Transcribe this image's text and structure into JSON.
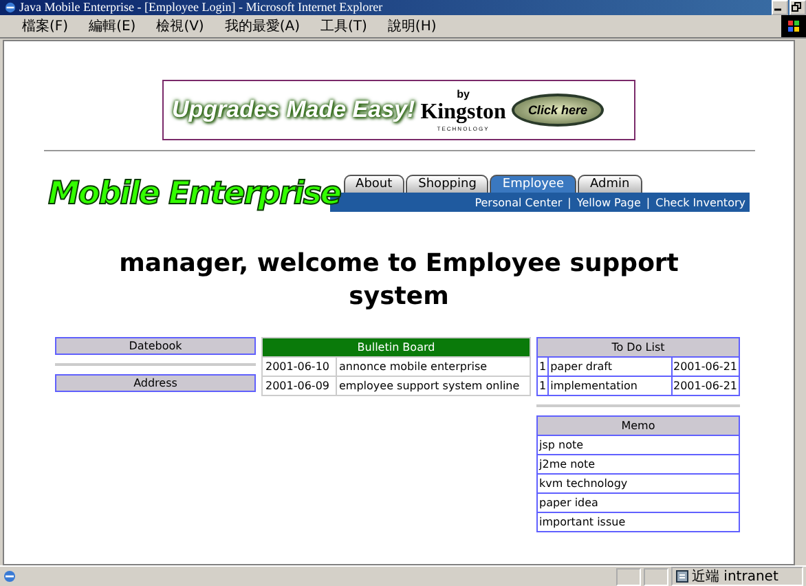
{
  "window": {
    "title": "Java Mobile Enterprise - [Employee Login] - Microsoft Internet Explorer"
  },
  "menu": [
    "檔案(F)",
    "編輯(E)",
    "檢視(V)",
    "我的最愛(A)",
    "工具(T)",
    "說明(H)"
  ],
  "banner": {
    "headline": "Upgrades Made Easy!",
    "by": "by",
    "brand": "Kingston",
    "brand_sub": "TECHNOLOGY",
    "button": "Click here"
  },
  "logo": "Mobile Enterprise",
  "tabs": [
    {
      "label": "About",
      "selected": false
    },
    {
      "label": "Shopping",
      "selected": false
    },
    {
      "label": "Employee",
      "selected": true
    },
    {
      "label": "Admin",
      "selected": false
    }
  ],
  "sublinks": [
    "Personal Center",
    "Yellow Page",
    "Check Inventory"
  ],
  "sublink_separator": "|",
  "heading": "manager, welcome to Employee support system",
  "left_panels": [
    "Datebook",
    "Address"
  ],
  "bulletin": {
    "title": "Bulletin Board",
    "rows": [
      {
        "date": "2001-06-10",
        "text": "annonce mobile enterprise"
      },
      {
        "date": "2001-06-09",
        "text": "employee support system online"
      }
    ]
  },
  "todo": {
    "title": "To Do List",
    "rows": [
      {
        "priority": "1",
        "task": "paper draft",
        "date": "2001-06-21"
      },
      {
        "priority": "1",
        "task": "implementation",
        "date": "2001-06-21"
      }
    ]
  },
  "memo": {
    "title": "Memo",
    "rows": [
      "jsp note",
      "j2me note",
      "kvm technology",
      "paper idea",
      "important issue"
    ]
  },
  "status_bar": {
    "zone": "近端 intranet"
  }
}
